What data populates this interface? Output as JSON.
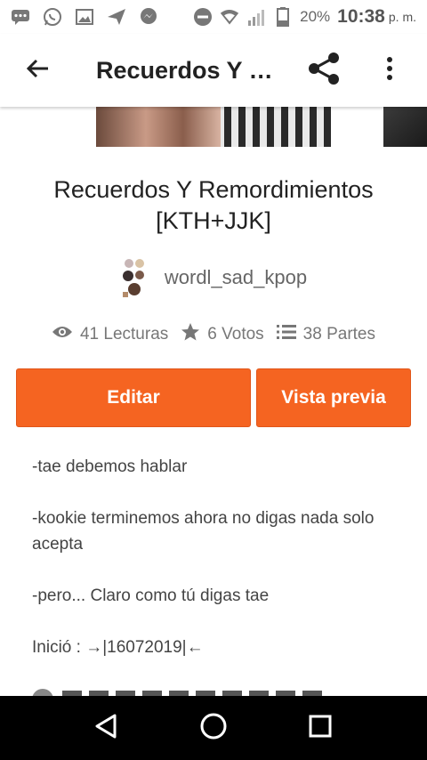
{
  "status_bar": {
    "battery_percent": "20%",
    "time": "10:38",
    "ampm": "p. m.",
    "icons": [
      "chat-bubble-icon",
      "whatsapp-icon",
      "gallery-icon",
      "send-icon",
      "messenger-icon",
      "do-not-disturb-icon",
      "wifi-icon",
      "signal-icon",
      "battery-icon"
    ]
  },
  "app_bar": {
    "title": "Recuerdos Y Remordimientos [KTH+JJK]",
    "icons": [
      "arrow-back-icon",
      "share-icon",
      "more-vert-icon"
    ]
  },
  "story": {
    "title": "Recuerdos Y Remordimientos [KTH+JJK]",
    "author": "wordl_sad_kpop",
    "reads": "41 Lecturas",
    "votes": "6 Votos",
    "parts": "38 Partes"
  },
  "buttons": {
    "edit": "Editar",
    "preview": "Vista previa"
  },
  "description": {
    "line1": "-tae debemos hablar",
    "line2": "-kookie terminemos ahora no digas nada solo acepta",
    "line3": "-pero... Claro como tú digas tae",
    "line4": "Inició : →|16072019|←"
  },
  "colors": {
    "accent": "#f56421",
    "nav_bg": "#000000"
  }
}
